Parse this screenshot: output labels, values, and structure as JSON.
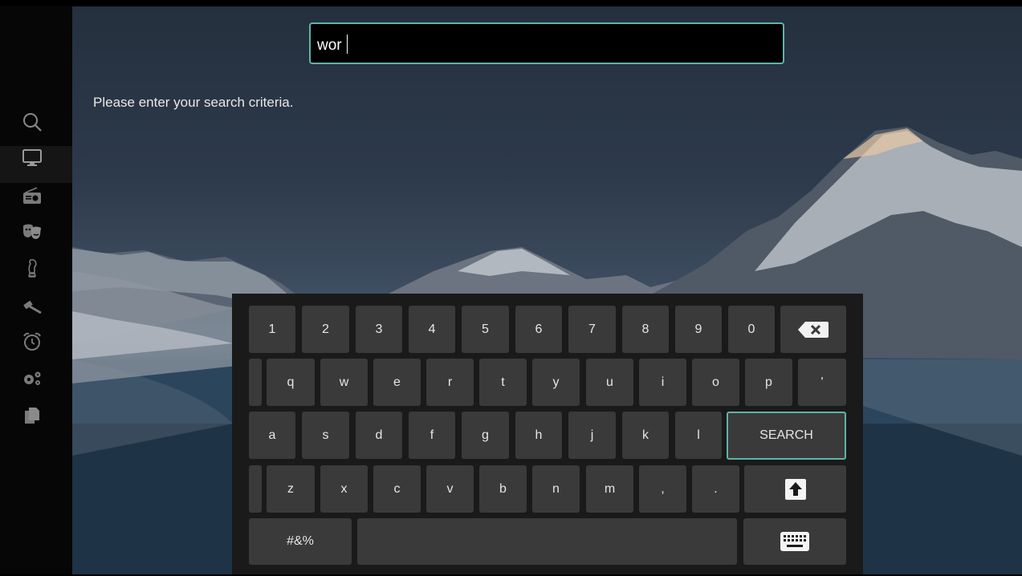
{
  "search": {
    "value": "wor"
  },
  "hint": "Please enter your search criteria.",
  "sidebar": {
    "items": [
      {
        "icon": "search-icon"
      },
      {
        "icon": "tv-icon"
      },
      {
        "icon": "radio-icon"
      },
      {
        "icon": "theater-masks-icon"
      },
      {
        "icon": "chess-knight-icon"
      },
      {
        "icon": "gavel-icon"
      },
      {
        "icon": "alarm-clock-icon"
      },
      {
        "icon": "settings-gears-icon"
      },
      {
        "icon": "copy-documents-icon"
      }
    ],
    "active_index": 1
  },
  "keyboard": {
    "row1": [
      "1",
      "2",
      "3",
      "4",
      "5",
      "6",
      "7",
      "8",
      "9",
      "0"
    ],
    "row2": [
      "q",
      "w",
      "e",
      "r",
      "t",
      "y",
      "u",
      "i",
      "o",
      "p",
      "'"
    ],
    "row3": [
      "a",
      "s",
      "d",
      "f",
      "g",
      "h",
      "j",
      "k",
      "l"
    ],
    "search_label": "SEARCH",
    "row4": [
      "z",
      "x",
      "c",
      "v",
      "b",
      "n",
      "m",
      ",",
      "."
    ],
    "symbols_label": "#&%",
    "icons": {
      "backspace": "backspace-icon",
      "shift": "shift-arrow-icon",
      "keyboard": "keyboard-icon"
    }
  },
  "colors": {
    "accent": "#5fb3a8",
    "key": "#3a3a3a",
    "keyboard_bg": "#1a1a1a",
    "sidebar_bg": "#060606"
  }
}
